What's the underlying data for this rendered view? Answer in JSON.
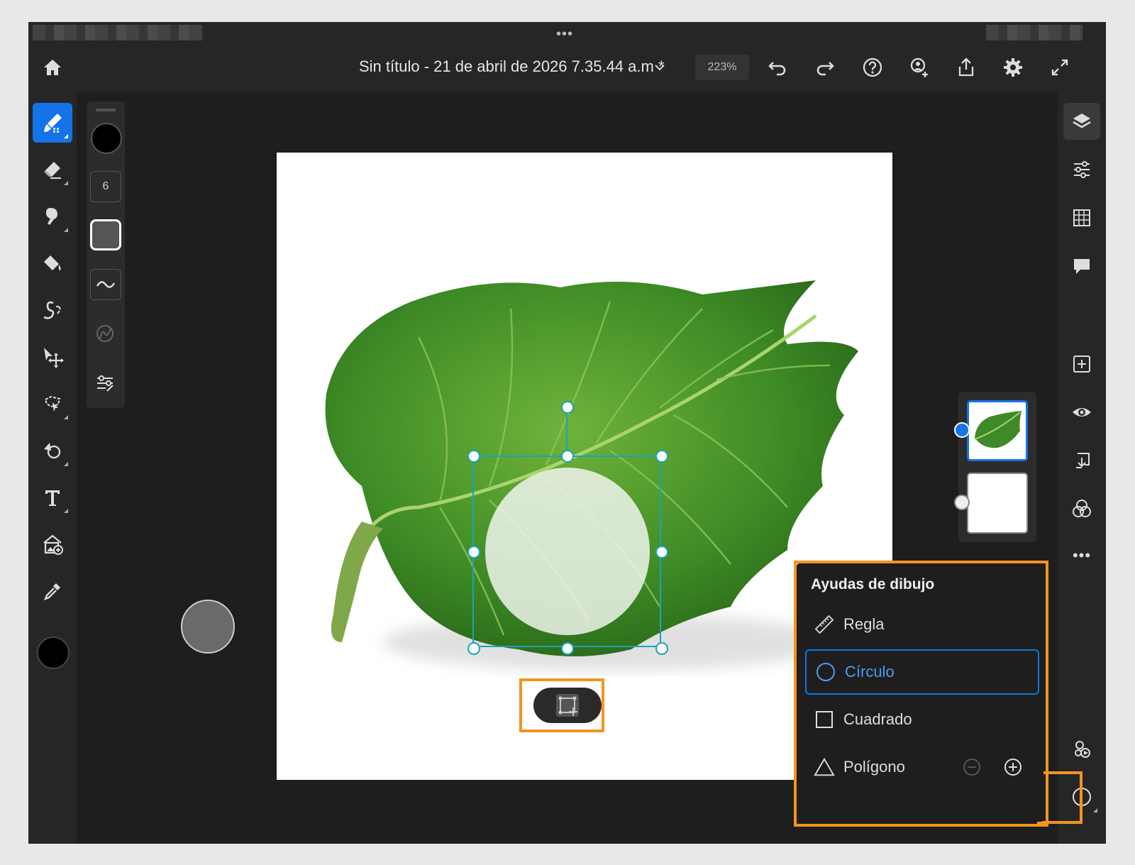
{
  "header": {
    "title": "Sin título - 21 de abril de 2026 7.35.44 a.m *",
    "zoom": "223%"
  },
  "brush_panel": {
    "size": "6"
  },
  "drawing_aids": {
    "title": "Ayudas de dibujo",
    "items": [
      {
        "label": "Regla",
        "icon": "ruler-icon",
        "selected": false
      },
      {
        "label": "Círculo",
        "icon": "circle-icon",
        "selected": true
      },
      {
        "label": "Cuadrado",
        "icon": "square-icon",
        "selected": false
      },
      {
        "label": "Polígono",
        "icon": "triangle-icon",
        "selected": false
      }
    ]
  },
  "colors": {
    "accent": "#1473e6",
    "highlight": "#f29423",
    "selection": "#1aa3b8"
  }
}
